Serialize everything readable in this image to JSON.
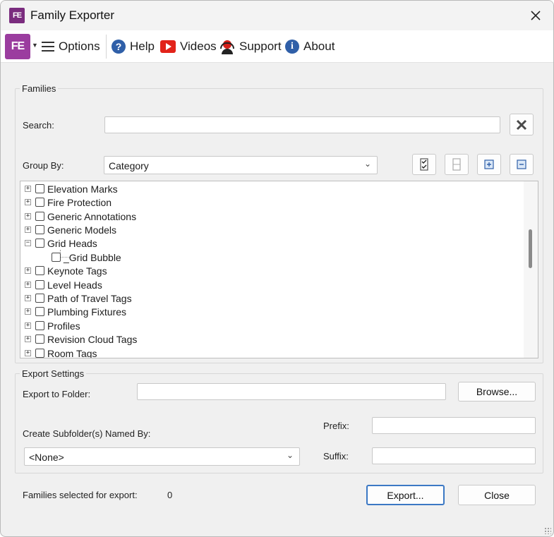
{
  "window": {
    "title": "Family Exporter",
    "logo_text": "FE"
  },
  "toolbar": {
    "logo_text": "FE",
    "options_label": "Options",
    "help_label": "Help",
    "help_icon_glyph": "?",
    "videos_label": "Videos",
    "support_label": "Support",
    "about_label": "About",
    "about_icon_glyph": "i"
  },
  "families": {
    "group_title": "Families",
    "search_label": "Search:",
    "search_value": "",
    "group_by_label": "Group By:",
    "group_by_value": "Category",
    "tree_items": [
      {
        "label": "Elevation Marks",
        "expander": "+",
        "depth": 0
      },
      {
        "label": "Fire Protection",
        "expander": "+",
        "depth": 0
      },
      {
        "label": "Generic Annotations",
        "expander": "+",
        "depth": 0
      },
      {
        "label": "Generic Models",
        "expander": "+",
        "depth": 0
      },
      {
        "label": "Grid Heads",
        "expander": "−",
        "depth": 0
      },
      {
        "label": "_Grid Bubble",
        "expander": "",
        "depth": 1
      },
      {
        "label": "Keynote Tags",
        "expander": "+",
        "depth": 0
      },
      {
        "label": "Level Heads",
        "expander": "+",
        "depth": 0
      },
      {
        "label": "Path of Travel Tags",
        "expander": "+",
        "depth": 0
      },
      {
        "label": "Plumbing Fixtures",
        "expander": "+",
        "depth": 0
      },
      {
        "label": "Profiles",
        "expander": "+",
        "depth": 0
      },
      {
        "label": "Revision Cloud Tags",
        "expander": "+",
        "depth": 0
      },
      {
        "label": "Room Tags",
        "expander": "+",
        "depth": 0
      }
    ]
  },
  "export_settings": {
    "group_title": "Export Settings",
    "export_folder_label": "Export to Folder:",
    "export_folder_value": "",
    "browse_label": "Browse...",
    "subfolder_label": "Create Subfolder(s) Named By:",
    "subfolder_value": "<None>",
    "prefix_label": "Prefix:",
    "prefix_value": "",
    "suffix_label": "Suffix:",
    "suffix_value": ""
  },
  "footer": {
    "selected_label": "Families selected for export:",
    "selected_count": "0",
    "export_label": "Export...",
    "close_label": "Close"
  },
  "colors": {
    "logo_purple": "#9b3d9f",
    "help_blue": "#2f5fa8",
    "video_red": "#e2231a",
    "primary_border": "#3b78c4"
  }
}
